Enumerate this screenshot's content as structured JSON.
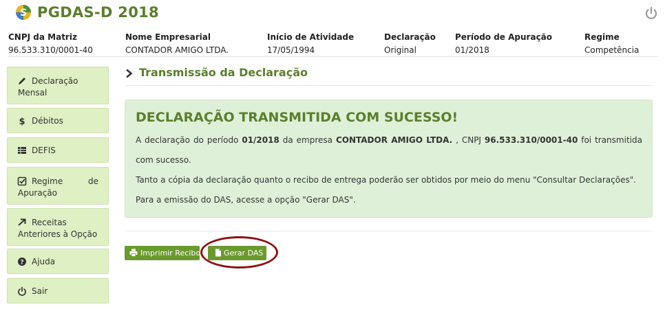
{
  "app": {
    "title": "PGDAS-D 2018"
  },
  "info": {
    "columns": [
      {
        "header": "CNPJ da Matriz",
        "value": "96.533.310/0001-40"
      },
      {
        "header": "Nome Empresarial",
        "value": "CONTADOR AMIGO LTDA."
      },
      {
        "header": "Início de Atividade",
        "value": "17/05/1994"
      },
      {
        "header": "Declaração",
        "value": "Original"
      },
      {
        "header": "Período de Apuração",
        "value": "01/2018"
      },
      {
        "header": "Regime",
        "value": "Competência"
      }
    ]
  },
  "sidebar": {
    "items": [
      {
        "label": "Declaração Mensal",
        "line1": "Declaração",
        "line2": "Mensal",
        "icon": "pencil-icon"
      },
      {
        "label": "Débitos",
        "icon": "dollar-icon"
      },
      {
        "label": "DEFIS",
        "icon": "table-icon"
      },
      {
        "label": "Regime de Apuração",
        "line1a": "Regime",
        "line1b": "de",
        "line2": "Apuração",
        "icon": "check-square-icon"
      },
      {
        "label": "Receitas Anteriores à Opção",
        "line1": "Receitas",
        "line2": "Anteriores à Opção",
        "icon": "arrow-right-icon"
      },
      {
        "label": "Ajuda",
        "icon": "question-icon"
      },
      {
        "label": "Sair",
        "icon": "power-icon"
      }
    ]
  },
  "section": {
    "title": "Transmissão da Declaração"
  },
  "alert": {
    "title": "DECLARAÇÃO TRANSMITIDA COM SUCESSO!",
    "p1_pre": "A declaração do período",
    "period": "01/2018",
    "p1_mid": "da empresa",
    "company": "CONTADOR AMIGO LTDA.",
    "p1_cnpj": ", CNPJ",
    "cnpj": "96.533.310/0001-40",
    "p1_post": "foi transmitida",
    "p1_cont": "com sucesso.",
    "p2": "Tanto a cópia da declaração quanto o recibo de entrega poderão ser obtidos por meio do menu \"Consultar Declarações\".",
    "p3": "Para a emissão do DAS, acesse a opção \"Gerar DAS\"."
  },
  "actions": {
    "print_label": "Imprimir Recibo",
    "gerar_label": "Gerar DAS"
  },
  "colors": {
    "brand_green": "#5a7f2b",
    "button_green": "#6a9a2e",
    "sidebar_bg": "#dff0c4",
    "alert_bg": "#dff0d8",
    "highlight": "#8e1212"
  }
}
